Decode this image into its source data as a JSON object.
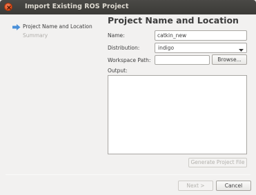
{
  "window": {
    "title": "Import Existing ROS Project"
  },
  "sidebar": {
    "items": [
      {
        "label": "Project Name and Location",
        "active": true
      },
      {
        "label": "Summary",
        "active": false
      }
    ]
  },
  "main": {
    "heading": "Project Name and Location",
    "name_label": "Name:",
    "name_value": "catkin_new",
    "distribution_label": "Distribution:",
    "distribution_value": "indigo",
    "workspace_label": "Workspace Path:",
    "workspace_value": "",
    "browse_label": "Browse...",
    "output_label": "Output:",
    "generate_label": "Generate Project File"
  },
  "footer": {
    "next_label": "Next >",
    "cancel_label": "Cancel"
  },
  "colors": {
    "accent_arrow": "#4a90d9",
    "close_button": "#df4b15",
    "titlebar": "#3b3a37"
  }
}
